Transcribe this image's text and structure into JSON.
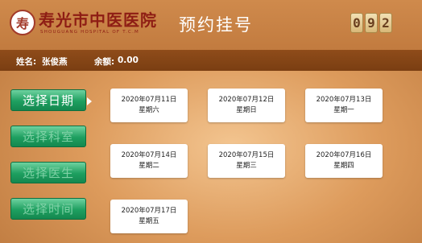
{
  "header": {
    "hospital_name": "寿光市中医医院",
    "hospital_name_en": "SHOUGUANG HOSPITAL OF T.C.M",
    "title": "预约挂号",
    "counter": [
      "0",
      "9",
      "2"
    ]
  },
  "info": {
    "name_label": "姓名:",
    "name_value": "张俊燕",
    "balance_label": "余额:",
    "balance_value": "0.00"
  },
  "nav": [
    {
      "label": "选择日期",
      "active": true
    },
    {
      "label": "选择科室",
      "active": false
    },
    {
      "label": "选择医生",
      "active": false
    },
    {
      "label": "选择时间",
      "active": false
    }
  ],
  "dates": [
    {
      "date": "2020年07月11日",
      "weekday": "星期六"
    },
    {
      "date": "2020年07月12日",
      "weekday": "星期日"
    },
    {
      "date": "2020年07月13日",
      "weekday": "星期一"
    },
    {
      "date": "2020年07月14日",
      "weekday": "星期二"
    },
    {
      "date": "2020年07月15日",
      "weekday": "星期三"
    },
    {
      "date": "2020年07月16日",
      "weekday": "星期四"
    },
    {
      "date": "2020年07月17日",
      "weekday": "星期五"
    }
  ],
  "colors": {
    "brand": "#8e1d14",
    "header_bg": "#c27b3f",
    "infobar_bg": "#7a3e12",
    "nav_green": "#1e9f60"
  }
}
